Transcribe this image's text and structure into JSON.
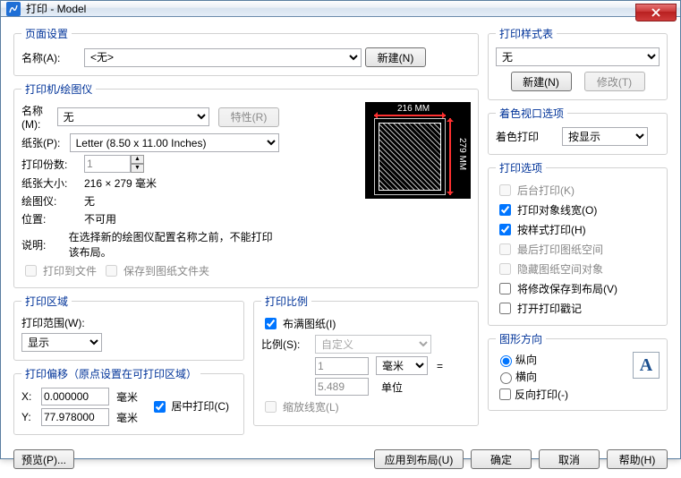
{
  "window": {
    "title": "打印 - Model"
  },
  "page_setup": {
    "legend": "页面设置",
    "name_label": "名称(A):",
    "name_value": "<无>",
    "new_btn": "新建(N)"
  },
  "printer": {
    "legend": "打印机/绘图仪",
    "name_label": "名称(M):",
    "name_value": "无",
    "props_btn": "特性(R)",
    "paper_label": "纸张(P):",
    "paper_value": "Letter (8.50 x 11.00 Inches)",
    "copies_label": "打印份数:",
    "copies_value": "1",
    "size_label": "纸张大小:",
    "size_value": "216 × 279  毫米",
    "plotter_label": "绘图仪:",
    "plotter_value": "无",
    "location_label": "位置:",
    "location_value": "不可用",
    "desc_label": "说明:",
    "desc_value": "在选择新的绘图仪配置名称之前，不能打印该布局。",
    "tofile": "打印到文件",
    "save_sheet": "保存到图纸文件夹",
    "preview_top": "216 MM",
    "preview_side": "279 MM"
  },
  "area": {
    "legend": "打印区域",
    "range_label": "打印范围(W):",
    "range_value": "显示"
  },
  "scale": {
    "legend": "打印比例",
    "fit": "布满图纸(I)",
    "scale_label": "比例(S):",
    "scale_value": "自定义",
    "num": "1",
    "unit_sel": "毫米",
    "eq": "=",
    "den": "5.489",
    "unit_text": "单位",
    "lw": "缩放线宽(L)"
  },
  "offset": {
    "legend": "打印偏移（原点设置在可打印区域）",
    "x_label": "X:",
    "x_value": "0.000000",
    "y_label": "Y:",
    "y_value": "77.978000",
    "unit": "毫米",
    "center": "居中打印(C)"
  },
  "style": {
    "legend": "打印样式表",
    "value": "无",
    "new_btn": "新建(N)",
    "edit_btn": "修改(T)"
  },
  "viewport": {
    "legend": "着色视口选项",
    "shade_label": "着色打印",
    "shade_value": "按显示"
  },
  "options": {
    "legend": "打印选项",
    "bg": "后台打印(K)",
    "lw": "打印对象线宽(O)",
    "styles": "按样式打印(H)",
    "paperspace": "最后打印图纸空间",
    "hide": "隐藏图纸空间对象",
    "save_layout": "将修改保存到布局(V)",
    "stamp": "打开打印戳记"
  },
  "orient": {
    "legend": "图形方向",
    "portrait": "纵向",
    "landscape": "横向",
    "upside": "反向打印(-)",
    "letter": "A"
  },
  "footer": {
    "preview": "预览(P)...",
    "apply_layout": "应用到布局(U)",
    "ok": "确定",
    "cancel": "取消",
    "help": "帮助(H)"
  }
}
